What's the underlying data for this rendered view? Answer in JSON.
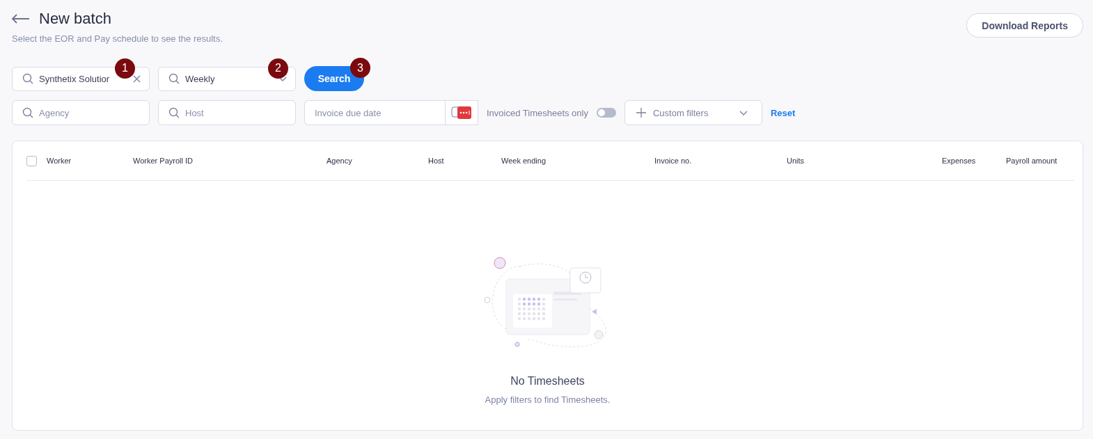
{
  "header": {
    "title": "New batch",
    "subtitle": "Select the EOR and Pay schedule to see the results.",
    "download_button": "Download Reports"
  },
  "primary_filters": {
    "eor": {
      "value": "Synthetix Solutior",
      "badge": "1"
    },
    "pay_schedule": {
      "value": "Weekly",
      "badge": "2"
    },
    "search_button": {
      "label": "Search",
      "badge": "3"
    }
  },
  "secondary_filters": {
    "agency": {
      "placeholder": "Agency"
    },
    "host": {
      "placeholder": "Host"
    },
    "invoice_due_date": {
      "placeholder": "Invoice due date"
    },
    "invoiced_only": {
      "label": "Invoiced Timesheets only",
      "on": false
    },
    "custom_filters": "Custom filters",
    "reset": "Reset"
  },
  "table": {
    "select_all": {
      "checked": false
    },
    "columns": [
      "Worker",
      "Worker Payroll ID",
      "Agency",
      "Host",
      "Week ending",
      "Invoice no.",
      "Units",
      "Expenses",
      "Payroll amount"
    ]
  },
  "empty_state": {
    "title": "No Timesheets",
    "message": "Apply filters to find Timesheets."
  }
}
